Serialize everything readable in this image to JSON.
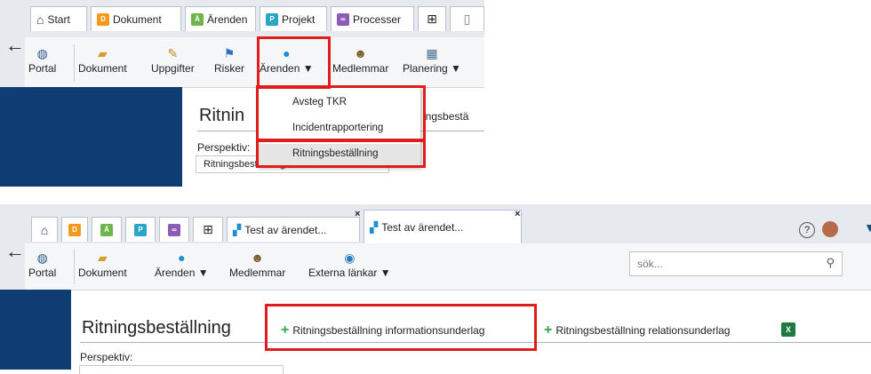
{
  "top": {
    "tabs": [
      {
        "label": "Start",
        "icon": "home-icon"
      },
      {
        "label": "Dokument",
        "icon": "document-module-icon"
      },
      {
        "label": "Ärenden",
        "icon": "cases-module-icon"
      },
      {
        "label": "Projekt",
        "icon": "project-module-icon"
      },
      {
        "label": "Processer",
        "icon": "process-module-icon"
      }
    ],
    "toolbar": {
      "portal": "Portal",
      "dokument": "Dokument",
      "uppgifter": "Uppgifter",
      "risker": "Risker",
      "arenden": "Ärenden ▼",
      "medlemmar": "Medlemmar",
      "planering": "Planering ▼"
    },
    "page_title": "Ritnin",
    "title_right": "ingsbestä",
    "perspektiv_label": "Perspektiv:",
    "perspektiv_value": "Ritningsbeställning relationsun",
    "dropdown_items": [
      "Avsteg TKR",
      "Incidentrapportering",
      "Ritningsbeställning"
    ]
  },
  "bottom": {
    "tabs": [
      {
        "label": "Test av ärendet..."
      },
      {
        "label": "Test av ärendet..."
      }
    ],
    "toolbar": {
      "portal": "Portal",
      "dokument": "Dokument",
      "arenden": "Ärenden ▼",
      "medlemmar": "Medlemmar",
      "externa": "Externa länkar ▼"
    },
    "search_placeholder": "sök...",
    "page_title": "Ritningsbeställning",
    "action1": "Ritningsbeställning informationsunderlag",
    "action2": "Ritningsbeställning relationsunderlag",
    "perspektiv_label": "Perspektiv:"
  },
  "colors": {
    "accent_red": "#e21b1b",
    "nav_blue": "#0f3c72",
    "plus_green": "#3aa64b"
  }
}
